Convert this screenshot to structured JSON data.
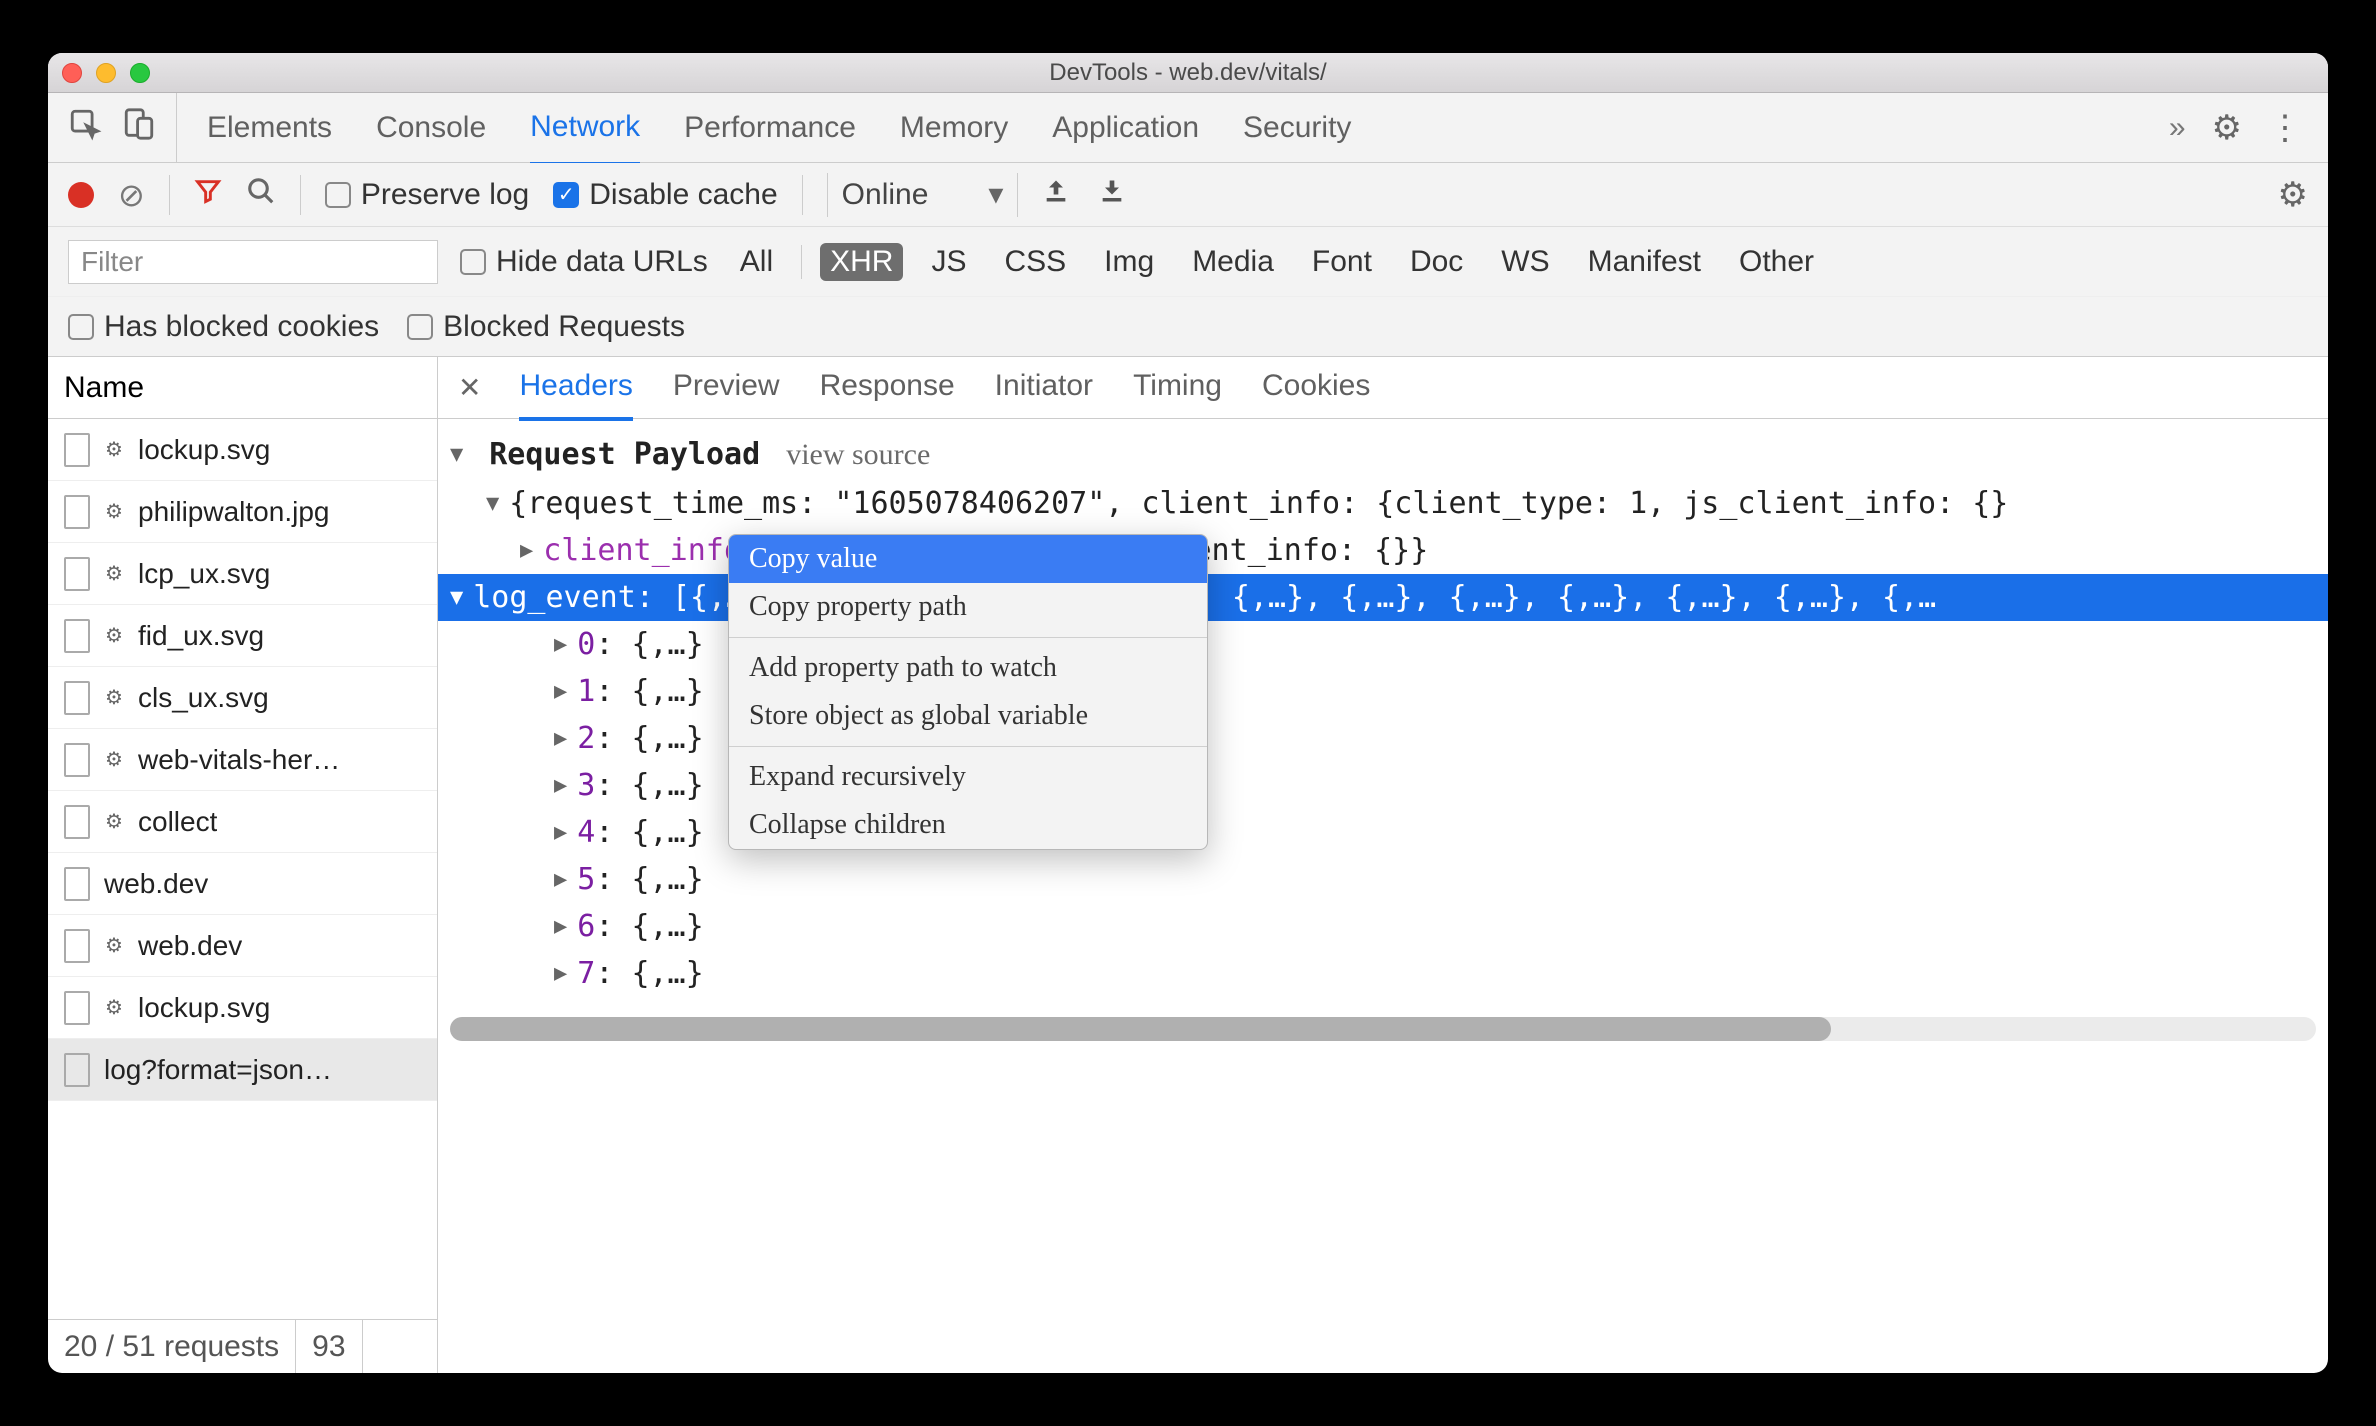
{
  "window": {
    "title": "DevTools - web.dev/vitals/"
  },
  "main_tabs": {
    "items": [
      "Elements",
      "Console",
      "Network",
      "Performance",
      "Memory",
      "Application",
      "Security"
    ],
    "active": "Network",
    "more_label": "»"
  },
  "toolbar": {
    "preserve_log": "Preserve log",
    "preserve_log_checked": false,
    "disable_cache": "Disable cache",
    "disable_cache_checked": true,
    "throttling": "Online"
  },
  "filterbar": {
    "filter_placeholder": "Filter",
    "hide_data_urls": "Hide data URLs",
    "types": [
      "All",
      "XHR",
      "JS",
      "CSS",
      "Img",
      "Media",
      "Font",
      "Doc",
      "WS",
      "Manifest",
      "Other"
    ],
    "active_type": "XHR",
    "has_blocked_cookies": "Has blocked cookies",
    "blocked_requests": "Blocked Requests"
  },
  "request_list": {
    "header": "Name",
    "rows": [
      {
        "icon": "cog",
        "name": "lockup.svg"
      },
      {
        "icon": "cog",
        "name": "philipwalton.jpg"
      },
      {
        "icon": "cog",
        "name": "lcp_ux.svg"
      },
      {
        "icon": "cog",
        "name": "fid_ux.svg"
      },
      {
        "icon": "cog",
        "name": "cls_ux.svg"
      },
      {
        "icon": "cog",
        "name": "web-vitals-her…"
      },
      {
        "icon": "cog",
        "name": "collect"
      },
      {
        "icon": "",
        "name": "web.dev"
      },
      {
        "icon": "cog",
        "name": "web.dev"
      },
      {
        "icon": "cog",
        "name": "lockup.svg"
      },
      {
        "icon": "",
        "name": "log?format=json…",
        "selected": true
      }
    ],
    "footer": {
      "requests": "20 / 51 requests",
      "size": "93"
    }
  },
  "detail_tabs": {
    "items": [
      "Headers",
      "Preview",
      "Response",
      "Initiator",
      "Timing",
      "Cookies"
    ],
    "active": "Headers"
  },
  "payload": {
    "section_title": "Request Payload",
    "view_source": "view source",
    "root_preview": "{request_time_ms: \"1605078406207\", client_info: {client_type: 1, js_client_info: {}",
    "client_info_key": "client_info",
    "client_info_val": "{client_type: 1, js_client_info: {}}",
    "log_event_key": "log_event",
    "log_event_preview": "[{,…}, {,…}, {,…}, {,…}, {,…}, {,…}, {,…}, {,…}, {,…}, {,…}, {,…}, {,…",
    "indices": [
      "0",
      "1",
      "2",
      "3",
      "4",
      "5",
      "6",
      "7"
    ],
    "index_val": "{,…}"
  },
  "context_menu": {
    "items": [
      "Copy value",
      "Copy property path",
      "Add property path to watch",
      "Store object as global variable",
      "Expand recursively",
      "Collapse children"
    ],
    "active": "Copy value",
    "separators_after": [
      1,
      3
    ]
  }
}
